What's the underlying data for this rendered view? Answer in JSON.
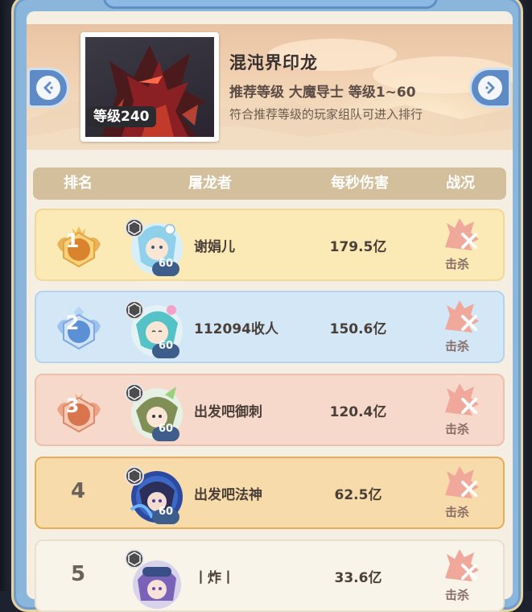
{
  "boss": {
    "name": "混沌界印龙",
    "level_badge": "等级240",
    "recommendation": "推荐等级  大魔导士  等级1~60",
    "note": "符合推荐等级的玩家组队可进入排行"
  },
  "nav": {
    "prev_icon": "chevron-left-icon",
    "next_icon": "chevron-right-icon"
  },
  "table": {
    "headers": {
      "rank": "排名",
      "slayer": "屠龙者",
      "dps": "每秒伤害",
      "status": "战况"
    },
    "rows": [
      {
        "rank": "1",
        "level": "60",
        "name": "谢娟儿",
        "dps": "179.5亿",
        "status": "击杀",
        "medal_color": "#e8a040"
      },
      {
        "rank": "2",
        "level": "60",
        "name": "112094收人",
        "dps": "150.6亿",
        "status": "击杀",
        "medal_color": "#6f9ee0"
      },
      {
        "rank": "3",
        "level": "60",
        "name": "出发吧御刺",
        "dps": "120.4亿",
        "status": "击杀",
        "medal_color": "#df8a66"
      },
      {
        "rank": "4",
        "level": "60",
        "name": "出发吧法神",
        "dps": "62.5亿",
        "status": "击杀"
      },
      {
        "rank": "5",
        "level": "",
        "name": "丨炸丨",
        "dps": "33.6亿",
        "status": "击杀"
      }
    ]
  },
  "colors": {
    "row_gold": "#fbeab6",
    "row_blue": "#d3e7f6",
    "row_pink": "#f6d9cb",
    "row_highlight": "#f8dbaa",
    "row_plain": "#f9f4ea",
    "header_bg": "#d3bf9c",
    "frame_blue": "#8bb6dc"
  }
}
